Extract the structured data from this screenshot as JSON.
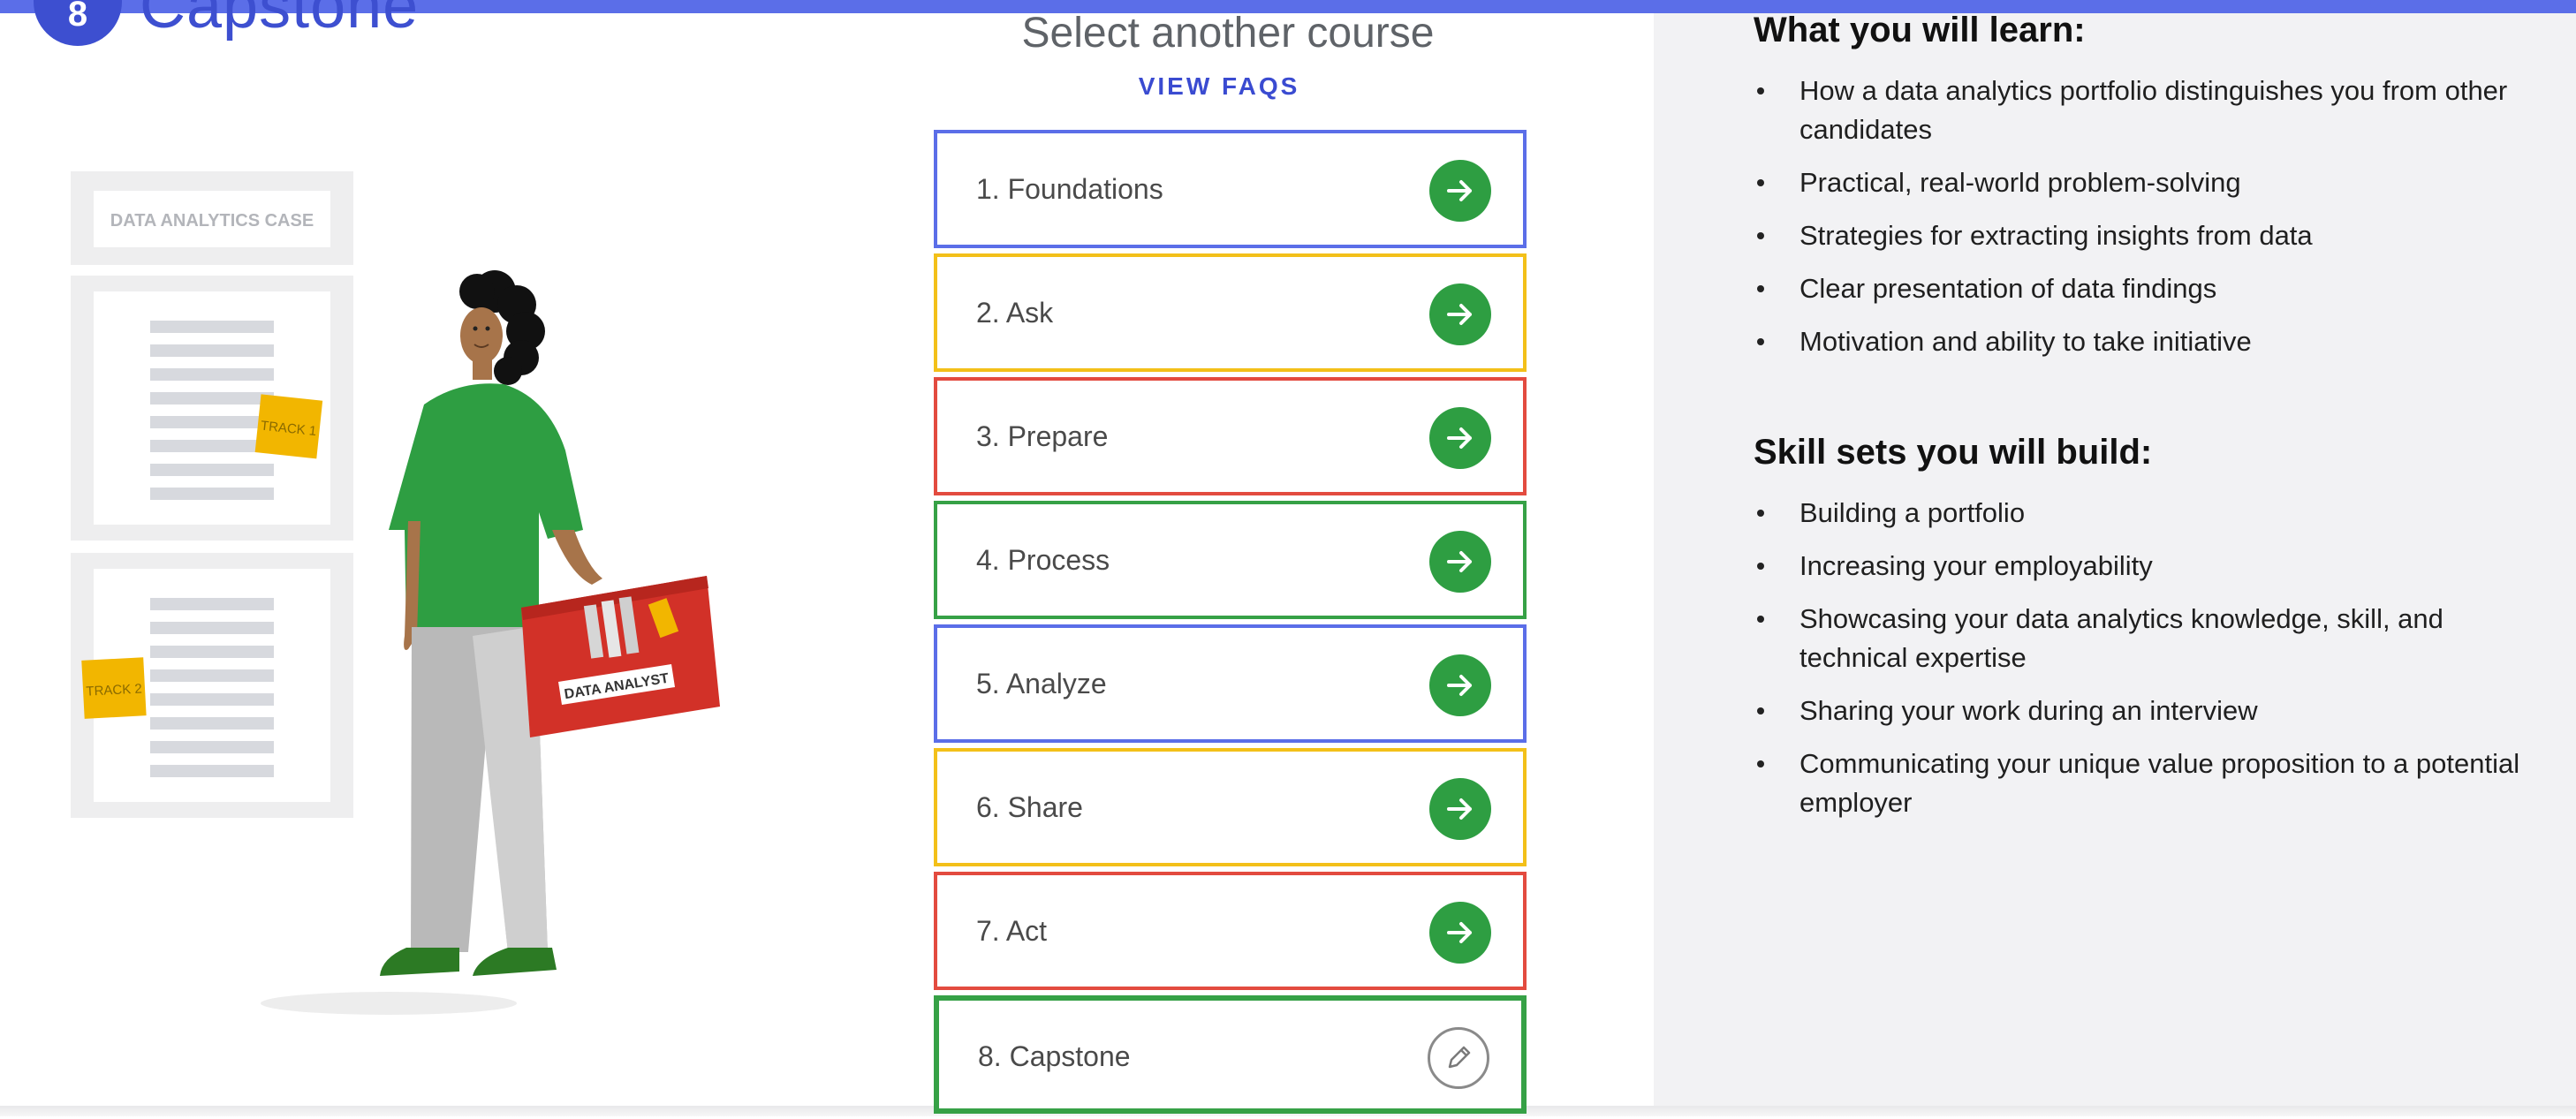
{
  "brand": {
    "badge_number": "8",
    "name": "Capstone"
  },
  "illustration": {
    "case_label": "DATA ANALYTICS CASE",
    "sticky_1": "TRACK 1",
    "sticky_2": "TRACK 2",
    "toolbox_label": "DATA ANALYST"
  },
  "center": {
    "title": "Select another course",
    "faq_link": "VIEW FAQS",
    "courses": [
      {
        "label": "1. Foundations",
        "action_icon": "arrow-right-icon",
        "border": "#5b6ee8"
      },
      {
        "label": "2. Ask",
        "action_icon": "arrow-right-icon",
        "border": "#f3c019"
      },
      {
        "label": "3. Prepare",
        "action_icon": "arrow-right-icon",
        "border": "#e34b3f"
      },
      {
        "label": "4. Process",
        "action_icon": "arrow-right-icon",
        "border": "#36a146"
      },
      {
        "label": "5. Analyze",
        "action_icon": "arrow-right-icon",
        "border": "#5b6ee8"
      },
      {
        "label": "6. Share",
        "action_icon": "arrow-right-icon",
        "border": "#f3c019"
      },
      {
        "label": "7. Act",
        "action_icon": "arrow-right-icon",
        "border": "#e34b3f"
      },
      {
        "label": "8. Capstone",
        "action_icon": "pencil-icon",
        "border": "#36a146"
      }
    ]
  },
  "learn": {
    "heading": "What you will learn:",
    "items": [
      "How a data analytics portfolio distinguishes you from other candidates",
      "Practical, real-world problem-solving",
      "Strategies for extracting insights from data",
      "Clear presentation of data findings",
      "Motivation and ability to take initiative"
    ]
  },
  "skills": {
    "heading": "Skill sets you will build:",
    "items": [
      "Building a portfolio",
      "Increasing your employability",
      "Showcasing your data analytics knowledge, skill, and technical expertise",
      "Sharing your work during an interview",
      "Communicating your unique value proposition to a potential employer"
    ]
  },
  "colors": {
    "accent": "#3d4fd0",
    "action_green": "#2e9e42",
    "topbar": "#5b6ee8"
  }
}
